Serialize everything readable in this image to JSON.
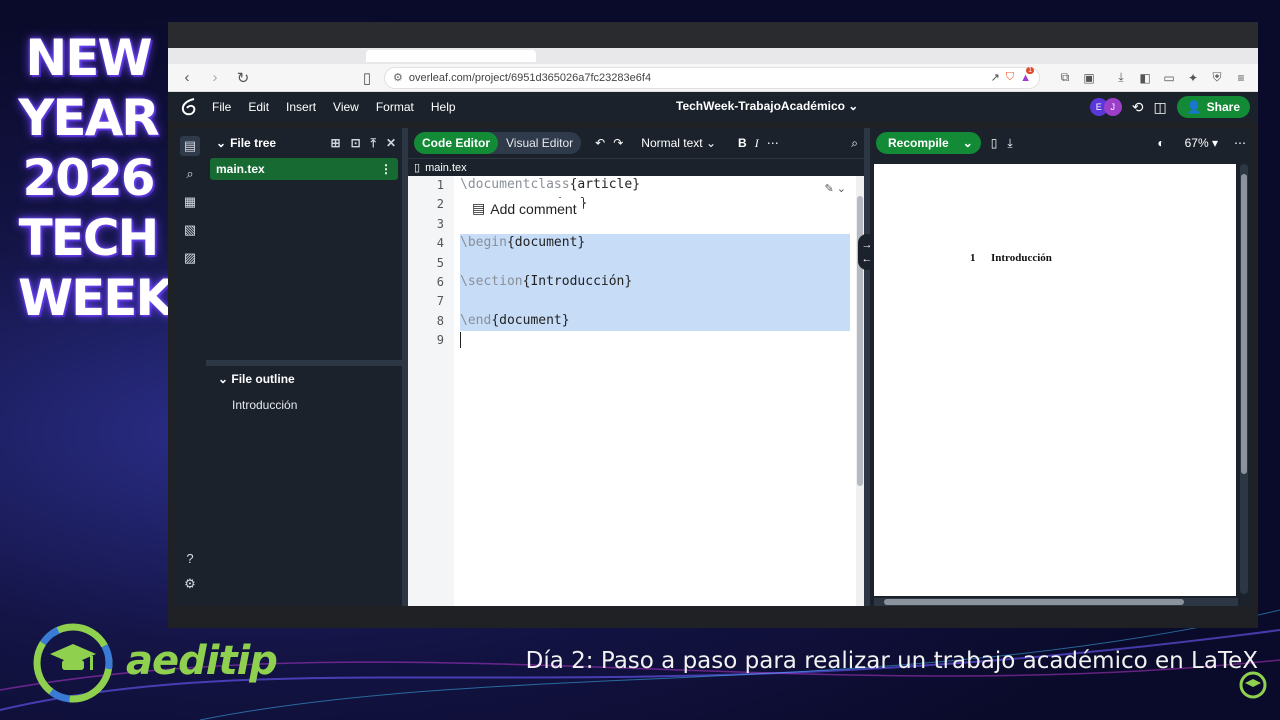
{
  "promo": {
    "line1": "NEW",
    "line2": "YEAR",
    "line3": "2026",
    "line4": "TECH",
    "line5": "WEEK",
    "brand_name": "aeditip",
    "caption": "Día 2: Paso a paso para realizar un trabajo académico en LaTeX"
  },
  "browser": {
    "url": "overleaf.com/project/6951d365026a7fc23283e6f4",
    "notification_count": "1"
  },
  "menu": [
    "File",
    "Edit",
    "Insert",
    "View",
    "Format",
    "Help"
  ],
  "project": {
    "title": "TechWeek-TrabajoAcadémico",
    "avatar_e": "E",
    "avatar_j": "J",
    "share_label": "Share"
  },
  "file_tree": {
    "title": "File tree",
    "file": "main.tex"
  },
  "outline": {
    "title": "File outline",
    "item": "Introducción"
  },
  "editor": {
    "code_editor_label": "Code Editor",
    "visual_editor_label": "Visual Editor",
    "text_style": "Normal text",
    "bold": "B",
    "italic": "I",
    "file_tab": "main.tex",
    "add_comment": "Add comment",
    "lines": [
      {
        "n": "1",
        "cmd": "\\documentclass",
        "arg": "{article}"
      },
      {
        "n": "2",
        "cmd": "",
        "arg": "icx}"
      },
      {
        "n": "3",
        "cmd": "",
        "arg": ""
      },
      {
        "n": "4",
        "cmd": "\\begin",
        "arg": "{document}"
      },
      {
        "n": "5",
        "cmd": "",
        "arg": ""
      },
      {
        "n": "6",
        "cmd": "\\section",
        "arg": "{Introducción}"
      },
      {
        "n": "7",
        "cmd": "",
        "arg": ""
      },
      {
        "n": "8",
        "cmd": "\\end",
        "arg": "{document}"
      },
      {
        "n": "9",
        "cmd": "",
        "arg": ""
      }
    ]
  },
  "pdf": {
    "recompile_label": "Recompile",
    "zoom": "67%",
    "section_number": "1",
    "section_title": "Introducción"
  },
  "colors": {
    "accent_green": "#138a36",
    "dark_bg": "#1b222c",
    "selection": "#c6dcf7",
    "brand_green": "#8fd14f"
  }
}
